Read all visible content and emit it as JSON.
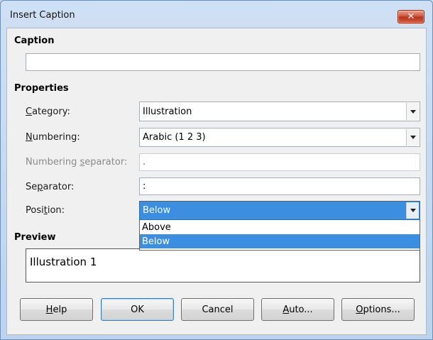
{
  "window": {
    "title": "Insert Caption",
    "close_glyph": "✕"
  },
  "caption": {
    "heading": "Caption",
    "value": ""
  },
  "properties": {
    "heading": "Properties",
    "category": {
      "label_pre": "",
      "label_key": "C",
      "label_post": "ategory:",
      "value": "Illustration"
    },
    "numbering": {
      "label_pre": "",
      "label_key": "N",
      "label_post": "umbering:",
      "value": "Arabic (1 2 3)"
    },
    "numbering_separator": {
      "label_pre": "Numbering ",
      "label_key": "s",
      "label_post": "eparator:",
      "value": "."
    },
    "separator": {
      "label_pre": "Se",
      "label_key": "p",
      "label_post": "arator:",
      "value": ":"
    },
    "position": {
      "label_pre": "Posi",
      "label_key": "t",
      "label_post": "ion:",
      "value": "Below",
      "options": [
        "Above",
        "Below"
      ],
      "highlighted": "Below"
    }
  },
  "preview": {
    "heading": "Preview",
    "text": "Illustration 1"
  },
  "buttons": {
    "help": {
      "pre": "",
      "key": "H",
      "post": "elp"
    },
    "ok": {
      "label": "OK"
    },
    "cancel": {
      "label": "Cancel"
    },
    "auto": {
      "pre": "",
      "key": "A",
      "post": "uto..."
    },
    "options": {
      "pre": "",
      "key": "O",
      "post": "ptions..."
    }
  },
  "icons": {
    "close": "close-icon",
    "dropdown": "chevron-down-icon"
  },
  "colors": {
    "selection": "#3c8ee0",
    "title_bar": "#c4d8ef",
    "close_button": "#c9442b"
  }
}
